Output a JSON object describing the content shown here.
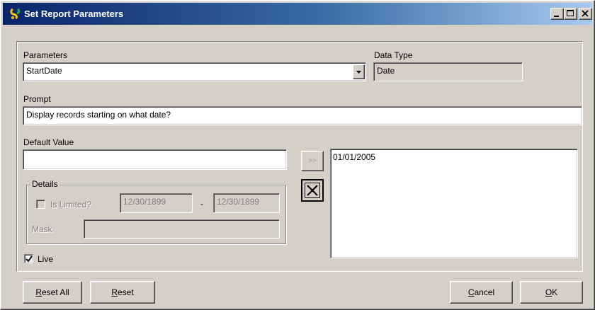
{
  "window": {
    "title": "Set Report Parameters"
  },
  "parameters": {
    "label": "Parameters",
    "value": "StartDate"
  },
  "data_type": {
    "label": "Data Type",
    "value": "Date"
  },
  "prompt": {
    "label": "Prompt",
    "value": "Display records starting on what date?"
  },
  "default_value": {
    "label": "Default Value",
    "value": ""
  },
  "add_button": {
    "label": ">>"
  },
  "values_list": {
    "items": [
      "01/01/2005"
    ]
  },
  "details": {
    "legend": "Details",
    "is_limited_label": "Is Limited?",
    "is_limited_checked": false,
    "min_date": "12/30/1899",
    "range_separator": "-",
    "max_date": "12/30/1899",
    "mask_label": "Mask",
    "mask_value": ""
  },
  "live": {
    "label": "Live",
    "checked": true
  },
  "buttons": {
    "reset_all": {
      "pre": "",
      "u": "R",
      "post": "eset All"
    },
    "reset": {
      "pre": "",
      "u": "R",
      "post": "eset"
    },
    "cancel": {
      "pre": "",
      "u": "C",
      "post": "ancel"
    },
    "ok": {
      "pre": "",
      "u": "O",
      "post": "K"
    }
  },
  "colors": {
    "titlebar_start": "#0a246a",
    "titlebar_end": "#a6caf0",
    "face": "#d4d0c8"
  }
}
